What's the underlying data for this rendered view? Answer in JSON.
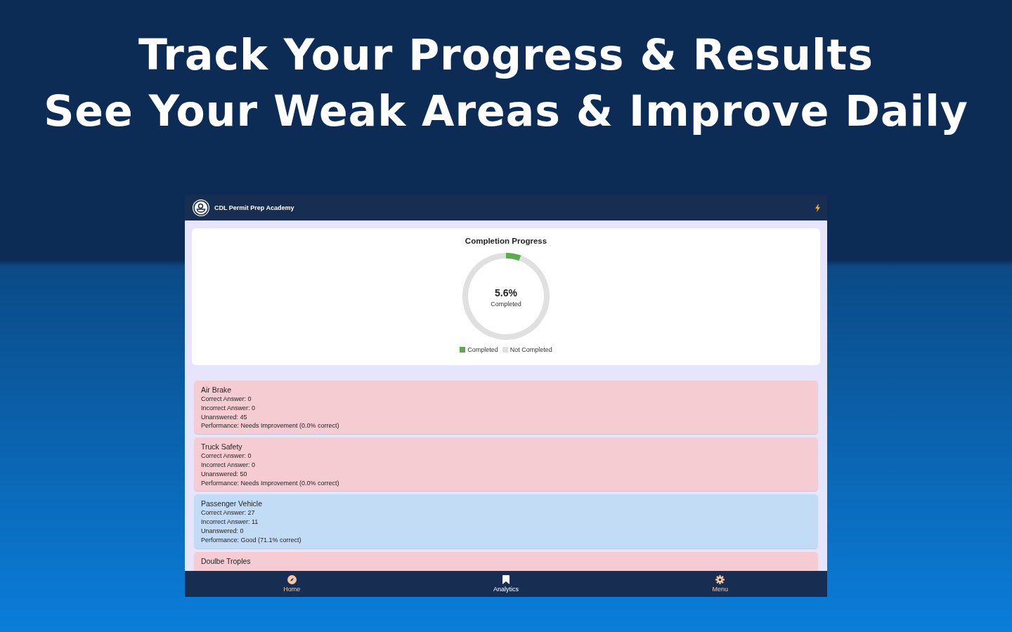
{
  "headline": [
    "Track Your Progress & Results",
    "See Your Weak Areas & Improve Daily"
  ],
  "app": {
    "title": "CDL Permit Prep Academy"
  },
  "progress": {
    "center_value": "5.6%",
    "center_label": "Completed",
    "chart_data": {
      "type": "donut",
      "title": "Completion Progress",
      "categories": [
        "Completed",
        "Not Completed"
      ],
      "series": [
        {
          "values": [
            5.6,
            94.4
          ]
        }
      ],
      "legend": "bottom"
    }
  },
  "topics": [
    {
      "name": "Air Brake",
      "color": "#f6ccd3",
      "lines": [
        "Correct Answer: 0",
        "Incorrect Answer: 0",
        "Unanswered: 45",
        "Performance: Needs Improvement (0.0% correct)"
      ]
    },
    {
      "name": "Truck Safety",
      "color": "#f6ccd3",
      "lines": [
        "Correct Answer: 0",
        "Incorrect Answer: 0",
        "Unanswered: 50",
        "Performance: Needs Improvement (0.0% correct)"
      ]
    },
    {
      "name": "Passenger Vehicle",
      "color": "#c2dcf6",
      "lines": [
        "Correct Answer: 27",
        "Incorrect Answer: 11",
        "Unanswered: 0",
        "Performance: Good (71.1% correct)"
      ]
    },
    {
      "name": "Doulbe Troples",
      "color": "#f6ccd3"
    }
  ],
  "tabs": [
    {
      "label": "Home",
      "selected": false
    },
    {
      "label": "Analytics",
      "selected": true
    },
    {
      "label": "Menu",
      "selected": false
    }
  ]
}
